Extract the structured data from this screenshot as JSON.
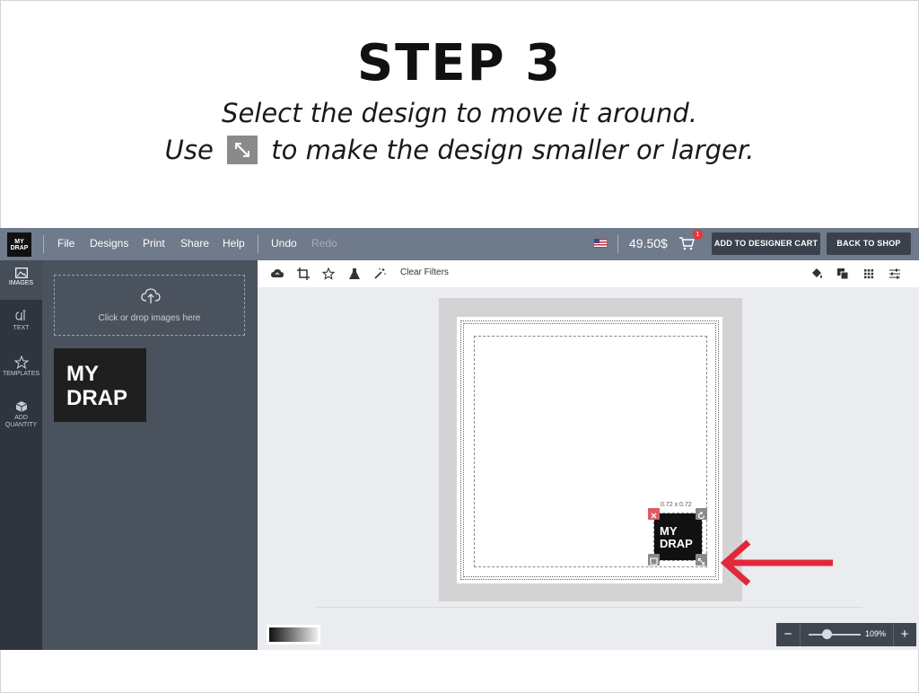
{
  "instructions": {
    "title": "STEP 3",
    "line1": "Select the design to move it around.",
    "line2_before": "Use",
    "line2_icon": "resize-diagonal-icon",
    "line2_after": "to make the design smaller or larger."
  },
  "topbar": {
    "logo_line1": "MY",
    "logo_line2": "DRAP",
    "menu": [
      "File",
      "Designs",
      "Print",
      "Share",
      "Help"
    ],
    "undo": "Undo",
    "redo": "Redo",
    "flag_icon": "us-flag-icon",
    "price": "49.50$",
    "cart_icon": "shopping-cart-icon",
    "cart_badge": "1",
    "add_to_cart": "ADD TO DESIGNER CART",
    "back_to_shop": "BACK TO SHOP"
  },
  "rail": {
    "items": [
      {
        "label": "IMAGES",
        "icon": "image-icon",
        "active": true
      },
      {
        "label": "TEXT",
        "icon": "text-icon",
        "active": false
      },
      {
        "label": "TEMPLATES",
        "icon": "star-icon",
        "active": false
      },
      {
        "label_line1": "ADD",
        "label_line2": "QUANTITY",
        "icon": "box-icon",
        "active": false
      }
    ]
  },
  "panel": {
    "upload_icon": "cloud-upload-icon",
    "dropzone_hint": "Click or drop images here",
    "thumbnail": {
      "line1": "MY",
      "line2": "DRAP"
    }
  },
  "toolbar": {
    "left_tools": [
      "cloud-icon",
      "crop-icon",
      "star-icon",
      "flask-icon",
      "magic-wand-icon"
    ],
    "clear_filters": "Clear Filters",
    "right_tools": [
      "paint-bucket-icon",
      "layers-icon",
      "grid-icon",
      "sliders-icon"
    ]
  },
  "canvas": {
    "design": {
      "line1": "MY",
      "line2": "DRAP"
    },
    "dimensions": "0.72 x 0.72",
    "handles": [
      "delete-icon",
      "rotate-icon",
      "layer-icon",
      "resize-icon"
    ]
  },
  "zoom": {
    "minus": "−",
    "plus": "+",
    "value": "109%",
    "slider_fraction": 0.35
  },
  "colors": {
    "topbar": "#6f7a8a",
    "rail": "#2f353e",
    "panel": "#4a525e",
    "arrow": "#e0283a",
    "delete_handle": "#e05a62"
  }
}
